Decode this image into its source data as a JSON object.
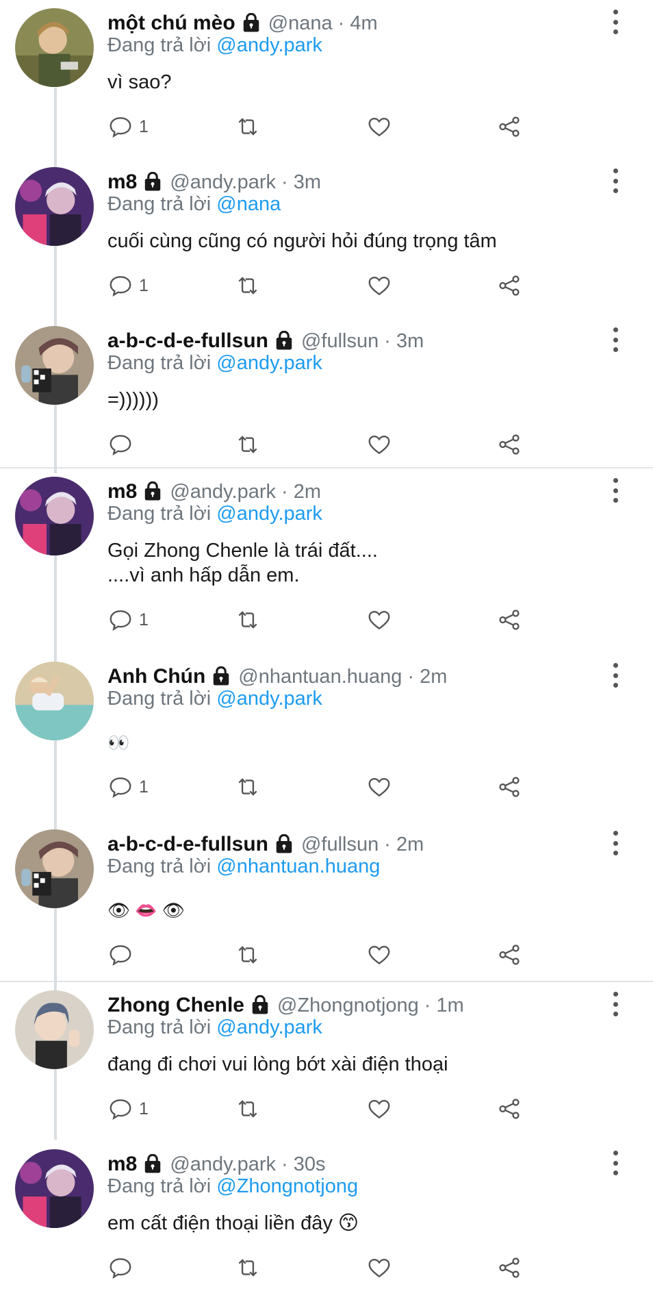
{
  "tweets": [
    {
      "name": "một chú mèo",
      "handle": "@nana",
      "time": "4m",
      "reply_prefix": "Đang trả lời",
      "reply_to": "@andy.park",
      "text_lines": [
        "vì sao?"
      ],
      "reply_count": "1"
    },
    {
      "name": "m8",
      "handle": "@andy.park",
      "time": "3m",
      "reply_prefix": "Đang trả lời",
      "reply_to": "@nana",
      "text_lines": [
        "cuối cùng cũng có người hỏi đúng trọng tâm"
      ],
      "reply_count": "1"
    },
    {
      "name": "a-b-c-d-e-fullsun",
      "handle": "@fullsun",
      "time": "3m",
      "reply_prefix": "Đang trả lời",
      "reply_to": "@andy.park",
      "text_lines": [
        "=))))))"
      ],
      "reply_count": ""
    },
    {
      "name": "m8",
      "handle": "@andy.park",
      "time": "2m",
      "reply_prefix": "Đang trả lời",
      "reply_to": "@andy.park",
      "text_lines": [
        "Gọi Zhong Chenle là trái đất....",
        "....vì anh hấp dẫn em."
      ],
      "reply_count": "1"
    },
    {
      "name": "Anh Chún",
      "handle": "@nhantuan.huang",
      "time": "2m",
      "reply_prefix": "Đang trả lời",
      "reply_to": "@andy.park",
      "text_lines": [
        "👀"
      ],
      "reply_count": "1"
    },
    {
      "name": "a-b-c-d-e-fullsun",
      "handle": "@fullsun",
      "time": "2m",
      "reply_prefix": "Đang trả lời",
      "reply_to": "@nhantuan.huang",
      "text_lines": [
        "👁 👄 👁"
      ],
      "reply_count": ""
    },
    {
      "name": "Zhong Chenle",
      "handle": "@Zhongnotjong",
      "time": "1m",
      "reply_prefix": "Đang trả lời",
      "reply_to": "@andy.park",
      "text_lines": [
        "đang đi chơi vui lòng bớt xài điện thoại"
      ],
      "reply_count": "1"
    },
    {
      "name": "m8",
      "handle": "@andy.park",
      "time": "30s",
      "reply_prefix": "Đang trả lời",
      "reply_to": "@Zhongnotjong",
      "text_lines": [
        "em cất điện thoại liền đây 😙"
      ],
      "reply_count": ""
    }
  ],
  "dot_separator": "·",
  "colors": {
    "mention": "#1d9bf0",
    "secondary": "#6e767d",
    "divider": "#e1e4e6",
    "thread_line": "#d9dde1"
  }
}
